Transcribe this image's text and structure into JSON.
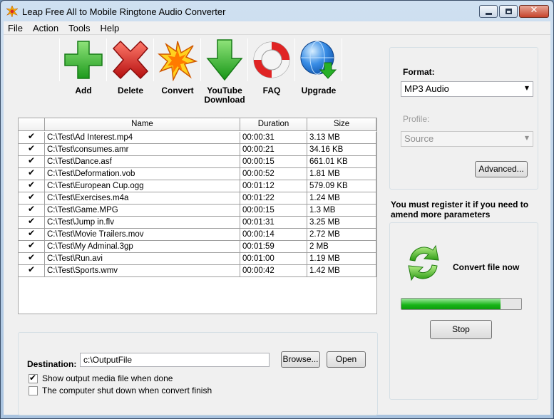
{
  "window": {
    "title": "Leap Free All to Mobile Ringtone Audio Converter"
  },
  "menu": [
    "File",
    "Action",
    "Tools",
    "Help"
  ],
  "toolbar": {
    "add_label": "Add",
    "delete_label": "Delete",
    "convert_label": "Convert",
    "youtube_label": "YouTube Download",
    "faq_label": "FAQ",
    "upgrade_label": "Upgrade"
  },
  "file_list": {
    "columns": [
      "",
      "Name",
      "Duration",
      "Size"
    ],
    "rows": [
      {
        "checked": true,
        "name": "C:\\Test\\Ad Interest.mp4",
        "duration": "00:00:31",
        "size": "3.13 MB"
      },
      {
        "checked": true,
        "name": "C:\\Test\\consumes.amr",
        "duration": "00:00:21",
        "size": "34.16 KB"
      },
      {
        "checked": true,
        "name": "C:\\Test\\Dance.asf",
        "duration": "00:00:15",
        "size": "661.01 KB"
      },
      {
        "checked": true,
        "name": "C:\\Test\\Deformation.vob",
        "duration": "00:00:52",
        "size": "1.81 MB"
      },
      {
        "checked": true,
        "name": "C:\\Test\\European Cup.ogg",
        "duration": "00:01:12",
        "size": "579.09 KB"
      },
      {
        "checked": true,
        "name": "C:\\Test\\Exercises.m4a",
        "duration": "00:01:22",
        "size": "1.24 MB"
      },
      {
        "checked": true,
        "name": "C:\\Test\\Game.MPG",
        "duration": "00:00:15",
        "size": "1.3 MB"
      },
      {
        "checked": true,
        "name": "C:\\Test\\Jump in.flv",
        "duration": "00:01:31",
        "size": "3.25 MB"
      },
      {
        "checked": true,
        "name": "C:\\Test\\Movie Trailers.mov",
        "duration": "00:00:14",
        "size": "2.72 MB"
      },
      {
        "checked": true,
        "name": "C:\\Test\\My Adminal.3gp",
        "duration": "00:01:59",
        "size": "2 MB"
      },
      {
        "checked": true,
        "name": "C:\\Test\\Run.avi",
        "duration": "00:01:00",
        "size": "1.19 MB"
      },
      {
        "checked": true,
        "name": "C:\\Test\\Sports.wmv",
        "duration": "00:00:42",
        "size": "1.42 MB"
      }
    ]
  },
  "destination": {
    "label": "Destination:",
    "value": "c:\\OutputFile",
    "browse_label": "Browse...",
    "open_label": "Open",
    "show_output_label": "Show output media file when done",
    "show_output_checked": true,
    "shutdown_label": "The computer shut down when convert finish",
    "shutdown_checked": false
  },
  "format_panel": {
    "format_label": "Format:",
    "format_value": "MP3 Audio",
    "profile_label": "Profile:",
    "profile_value": "Source",
    "advanced_label": "Advanced..."
  },
  "notice": "You must register it if you need to amend more parameters",
  "convert_panel": {
    "convert_now_label": "Convert file now",
    "progress_fraction": 0.83,
    "stop_label": "Stop"
  },
  "colors": {
    "add_green": "#2fb52f",
    "delete_red": "#d42020",
    "progress_green": "#17b417"
  }
}
